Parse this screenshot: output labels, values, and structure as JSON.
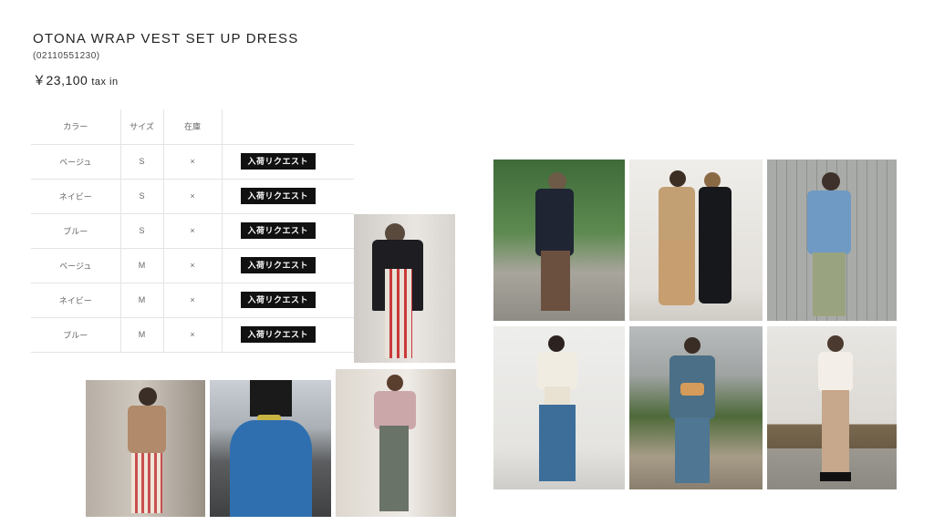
{
  "product": {
    "title": "OTONA WRAP VEST SET UP DRESS",
    "code": "(02110551230)",
    "price": "￥23,100",
    "tax_label": "tax in"
  },
  "stock_table": {
    "headers": [
      "カラー",
      "サイズ",
      "在庫",
      ""
    ],
    "rows": [
      {
        "color": "ベージュ",
        "size": "S",
        "stock": "×",
        "action": "入荷リクエスト"
      },
      {
        "color": "ネイビー",
        "size": "S",
        "stock": "×",
        "action": "入荷リクエスト"
      },
      {
        "color": "ブルー",
        "size": "S",
        "stock": "×",
        "action": "入荷リクエスト"
      },
      {
        "color": "ベージュ",
        "size": "M",
        "stock": "×",
        "action": "入荷リクエスト"
      },
      {
        "color": "ネイビー",
        "size": "M",
        "stock": "×",
        "action": "入荷リクエスト"
      },
      {
        "color": "ブルー",
        "size": "M",
        "stock": "×",
        "action": "入荷リクエスト"
      }
    ]
  },
  "colors": {
    "button_bg": "#111111",
    "text": "#222222",
    "divider": "#e4e4e4"
  }
}
